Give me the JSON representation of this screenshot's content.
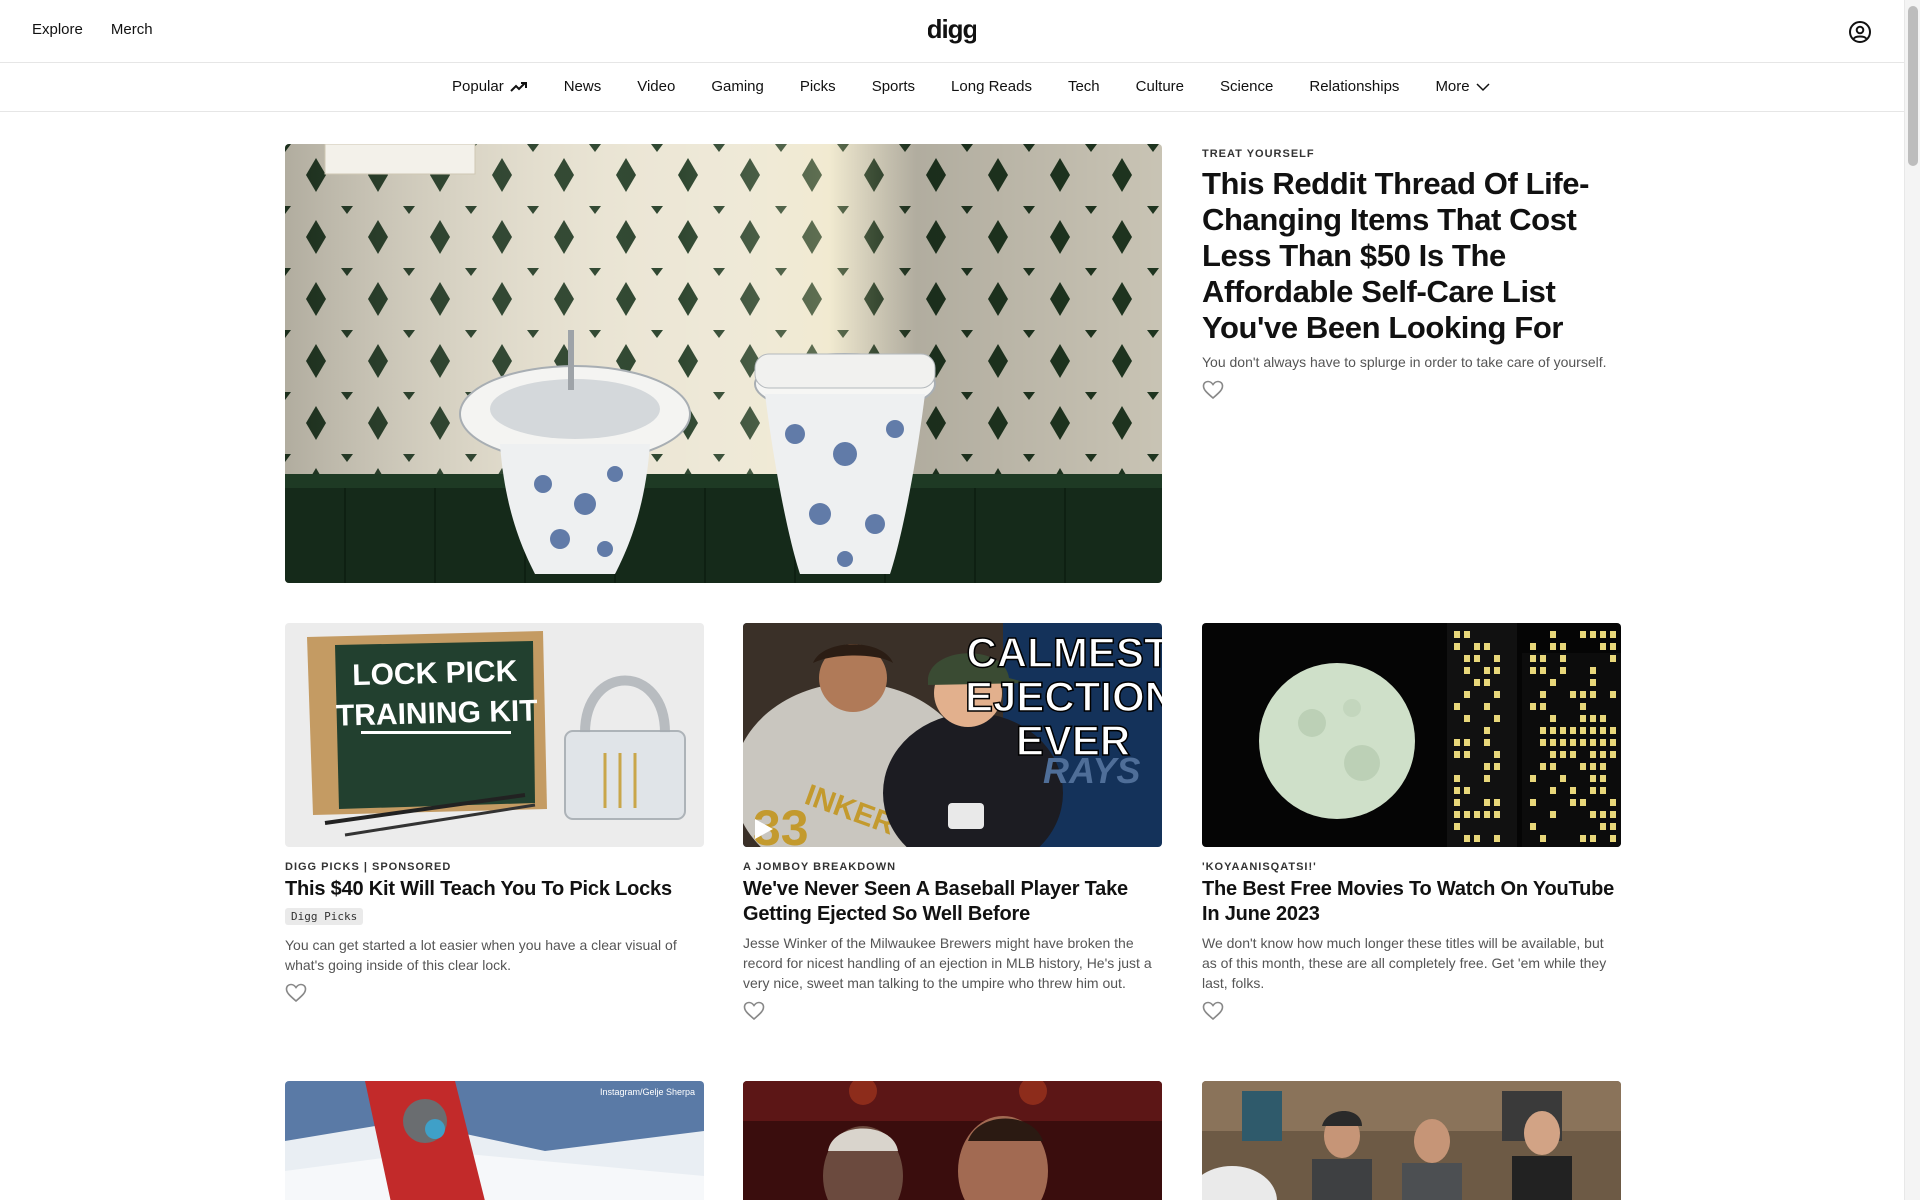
{
  "header": {
    "explore_label": "Explore",
    "merch_label": "Merch",
    "logo_text": "digg",
    "account_icon": "account-circle-icon"
  },
  "nav": {
    "items": [
      {
        "label": "Popular",
        "icon": "trending-up-icon"
      },
      {
        "label": "News"
      },
      {
        "label": "Video"
      },
      {
        "label": "Gaming"
      },
      {
        "label": "Picks"
      },
      {
        "label": "Sports"
      },
      {
        "label": "Long Reads"
      },
      {
        "label": "Tech"
      },
      {
        "label": "Culture"
      },
      {
        "label": "Science"
      },
      {
        "label": "Relationships"
      },
      {
        "label": "More",
        "icon": "chevron-down-icon"
      }
    ]
  },
  "hero": {
    "kicker": "TREAT YOURSELF",
    "title": "This Reddit Thread Of Life-Changing Items That Cost Less Than $50 Is The Affordable Self-Care List You've Been Looking For",
    "description": "You don't always have to splurge in order to take care of yourself.",
    "image": "bidet-and-toilet-tiled-bathroom-photo"
  },
  "cards": [
    {
      "kicker": "DIGG PICKS | SPONSORED",
      "title": "This $40 Kit Will Teach You To Pick Locks",
      "tag": "Digg Picks",
      "description": "You can get started a lot easier when you have a clear visual of what's going inside of this clear lock.",
      "image": "lock-pick-training-kit-photo",
      "image_text": [
        "LOCK PICK",
        "TRAINING KIT"
      ]
    },
    {
      "kicker": "A JOMBOY BREAKDOWN",
      "title": "We've Never Seen A Baseball Player Take Getting Ejected So Well Before",
      "description": "Jesse Winker of the Milwaukee Brewers might have broken the record for nicest handling of an ejection in MLB history, He's just a very nice, sweet man talking to the umpire who threw him out.",
      "image": "baseball-ejection-video-thumbnail",
      "image_text": [
        "CALMEST",
        "EJECTION",
        "EVER"
      ],
      "jersey_text": "INKER",
      "jersey_number": "33",
      "background_text": "RAYS"
    },
    {
      "kicker": "'KOYAANISQATSI!'",
      "title": "The Best Free Movies To Watch On YouTube In June 2023",
      "description": "We don't know how much longer these titles will be available, but as of this month, these are all completely free. Get 'em while they last, folks.",
      "image": "full-moon-over-city-photo"
    }
  ],
  "bottom_row": [
    {
      "image": "mountaineer-on-snow-photo",
      "credit": "Instagram/Gelje Sherpa"
    },
    {
      "image": "two-men-red-lit-scene-photo"
    },
    {
      "image": "men-seated-at-table-photo"
    }
  ],
  "colors": {
    "text": "#111111",
    "muted": "#555555",
    "border": "#e6e6e6"
  }
}
